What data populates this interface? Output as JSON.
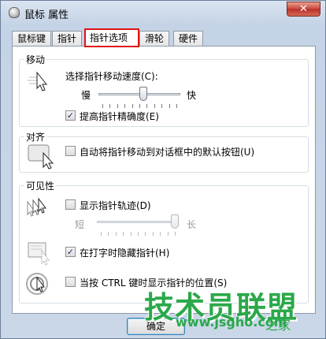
{
  "window": {
    "title": "鼠标 属性",
    "close_glyph": "✕",
    "icon": "mouse-icon"
  },
  "tabs": [
    {
      "label": "鼠标键",
      "active": false
    },
    {
      "label": "指针",
      "active": false
    },
    {
      "label": "指针选项",
      "active": true
    },
    {
      "label": "滑轮",
      "active": false
    },
    {
      "label": "硬件",
      "active": false
    }
  ],
  "motion": {
    "title": "移动",
    "speed_label": "选择指针移动速度(C):",
    "slow": "慢",
    "fast": "快",
    "speed_value": 0.55,
    "precision_label": "提高指针精确度(E)",
    "precision_checked": true
  },
  "snap": {
    "title": "对齐",
    "label": "自动将指针移动到对话框中的默认按钮(U)",
    "checked": false
  },
  "visibility": {
    "title": "可见性",
    "trails_label": "显示指针轨迹(D)",
    "trails_checked": false,
    "short": "短",
    "long": "长",
    "trails_value": 1.0,
    "hide_label": "在打字时隐藏指针(H)",
    "hide_checked": true,
    "ctrl_label": "当按 CTRL 键时显示指针的位置(S)",
    "ctrl_checked": false
  },
  "buttons": {
    "ok": "确定"
  },
  "watermark": {
    "main": "技术员联盟",
    "url": "www.jsgho.com",
    "sub": "之家"
  },
  "colors": {
    "highlight": "#e01515",
    "watermark": "#2ba84a"
  }
}
